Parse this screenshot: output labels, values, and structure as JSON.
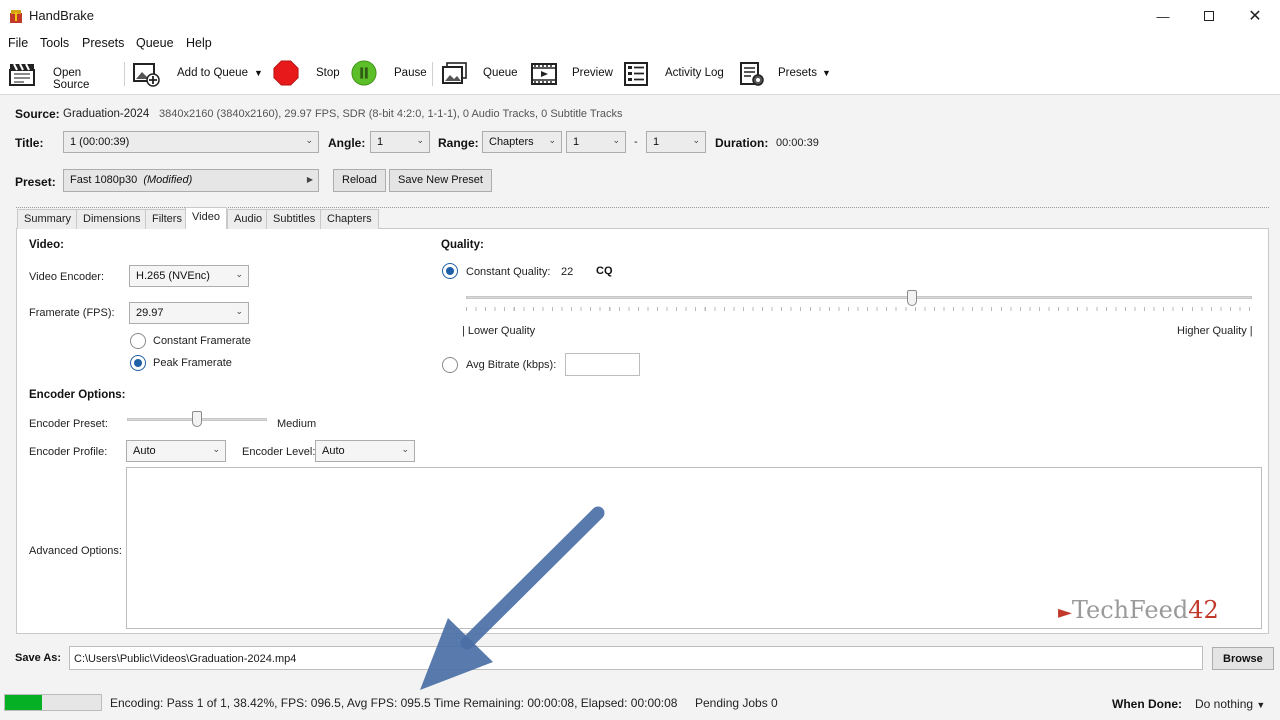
{
  "window": {
    "title": "HandBrake"
  },
  "menu": [
    "File",
    "Tools",
    "Presets",
    "Queue",
    "Help"
  ],
  "toolbar": {
    "open_source": "Open Source",
    "add_to_queue": "Add to Queue",
    "stop": "Stop",
    "pause": "Pause",
    "queue": "Queue",
    "preview": "Preview",
    "activity_log": "Activity Log",
    "presets": "Presets"
  },
  "source": {
    "label": "Source:",
    "name": "Graduation-2024",
    "info": "3840x2160 (3840x2160), 29.97 FPS, SDR (8-bit 4:2:0, 1-1-1), 0 Audio Tracks, 0 Subtitle Tracks"
  },
  "title_row": {
    "title_label": "Title:",
    "title_value": "1  (00:00:39)",
    "angle_label": "Angle:",
    "angle_value": "1",
    "range_label": "Range:",
    "range_type": "Chapters",
    "range_from": "1",
    "range_dash": "-",
    "range_to": "1",
    "duration_label": "Duration:",
    "duration_value": "00:00:39"
  },
  "preset": {
    "label": "Preset:",
    "name": "Fast 1080p30",
    "modified": "(Modified)",
    "reload": "Reload",
    "save_new": "Save New Preset"
  },
  "tabs": [
    "Summary",
    "Dimensions",
    "Filters",
    "Video",
    "Audio",
    "Subtitles",
    "Chapters"
  ],
  "active_tab": "Video",
  "video": {
    "heading": "Video:",
    "encoder_label": "Video Encoder:",
    "encoder_value": "H.265 (NVEnc)",
    "framerate_label": "Framerate (FPS):",
    "framerate_value": "29.97",
    "constant_framerate": "Constant Framerate",
    "peak_framerate": "Peak Framerate"
  },
  "quality": {
    "heading": "Quality:",
    "constant_quality_label": "Constant Quality:",
    "constant_quality_value": "22",
    "constant_quality_unit": "CQ",
    "slider_fraction": 0.567,
    "lower_quality": "| Lower Quality",
    "higher_quality": "Higher Quality |",
    "avg_bitrate_label": "Avg Bitrate (kbps):",
    "avg_bitrate_value": ""
  },
  "encoder_options": {
    "heading": "Encoder Options:",
    "preset_label": "Encoder Preset:",
    "preset_value": "Medium",
    "preset_slider_fraction": 0.5,
    "profile_label": "Encoder Profile:",
    "profile_value": "Auto",
    "level_label": "Encoder Level:",
    "level_value": "Auto",
    "advanced_label": "Advanced Options:",
    "advanced_value": ""
  },
  "save_as": {
    "label": "Save As:",
    "path": "C:\\Users\\Public\\Videos\\Graduation-2024.mp4",
    "browse": "Browse"
  },
  "status": {
    "progress_percent": 38.42,
    "text": "Encoding: Pass 1 of 1,  38.42%, FPS: 096.5,  Avg FPS: 095.5 Time Remaining: 00:00:08,  Elapsed: 00:00:08",
    "pending": "Pending Jobs 0",
    "when_done_label": "When Done:",
    "when_done_value": "Do nothing"
  },
  "watermark": {
    "text": "TechFeed",
    "number": "42"
  },
  "colors": {
    "accent": "#1f5fa8",
    "progress": "#06b025",
    "stop": "#e8191a",
    "pause": "#5cbf2a",
    "arrow": "#4a6fa5"
  }
}
